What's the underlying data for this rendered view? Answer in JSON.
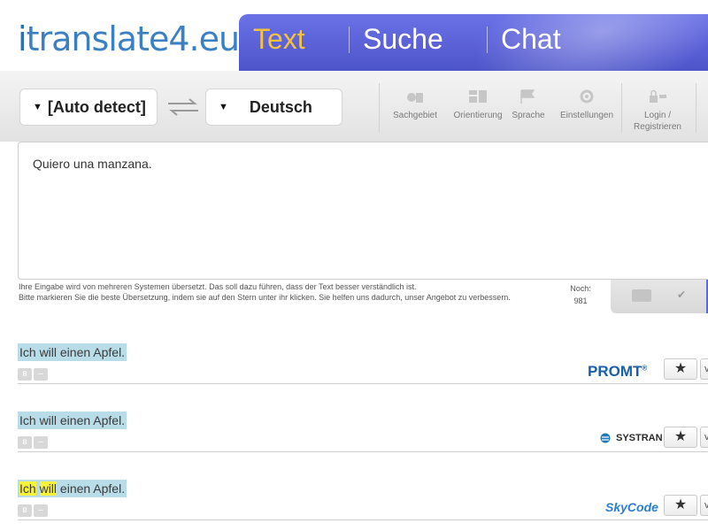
{
  "header": {
    "logo_text": "translate4.eu",
    "logo_i": "i",
    "tabs": [
      {
        "label": "Text",
        "active": true
      },
      {
        "label": "Suche",
        "active": false
      },
      {
        "label": "Chat",
        "active": false
      }
    ]
  },
  "toolbar": {
    "source_lang": "[Auto detect]",
    "target_lang": "Deutsch",
    "tools": [
      {
        "label": "Sachgebiet",
        "icon": "subject-icon"
      },
      {
        "label": "Orientierung",
        "icon": "layout-icon"
      },
      {
        "label": "Sprache",
        "icon": "flag-icon"
      },
      {
        "label": "Einstellungen",
        "icon": "settings-icon"
      },
      {
        "label": "Login / Registrieren",
        "icon": "lock-icon"
      }
    ]
  },
  "input": {
    "text": "Quiero una manzana."
  },
  "info": {
    "line1": "Ihre Eingabe wird von mehreren Systemen übersetzt. Das soll dazu führen, dass der Text besser verständlich ist.",
    "line2": "Bitte markieren Sie die beste Übersetzung, indem sie auf den Stern unter ihr klicken. Sie helfen uns dadurch, unser Angebot zu verbessern.",
    "noch_label": "Noch:",
    "noch_value": "981"
  },
  "results": [
    {
      "text": "Ich will einen Apfel.",
      "provider": "PROMT",
      "provider_mark": "®"
    },
    {
      "text": "Ich will einen Apfel.",
      "provider": "SYSTRAN"
    },
    {
      "text_hl1": "Ich",
      "text_hl2": "will",
      "text_rest": " einen Apfel.",
      "provider": "SkyCode"
    }
  ],
  "colors": {
    "nav_bg": "#5a5fd6",
    "active_tab": "#f5c23c",
    "result_highlight": "#b8dde8",
    "word_highlight": "#f7f33a",
    "promt_blue": "#1a5fa8",
    "skycode_blue": "#2a7fd0"
  }
}
